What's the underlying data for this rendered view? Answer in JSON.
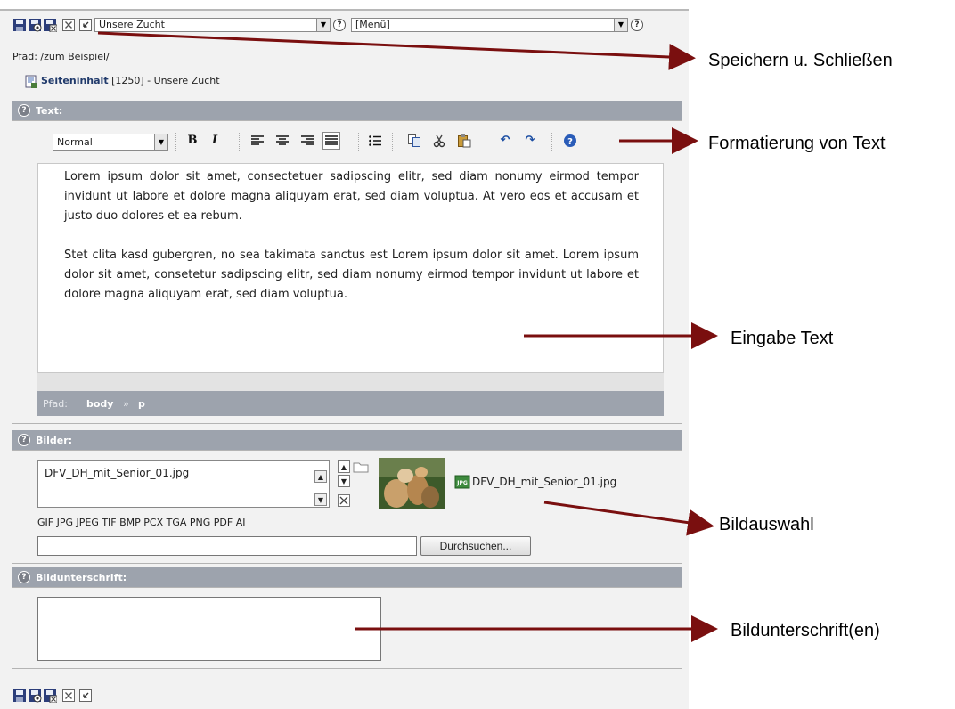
{
  "toolbar": {
    "page_select_value": "Unsere Zucht",
    "menu_select_value": "[Menü]",
    "icons": [
      "save-icon",
      "save-view-icon",
      "save-close-icon",
      "close-icon",
      "undo-icon"
    ]
  },
  "path_text": "Pfad: /zum Beispiel/",
  "record": {
    "type": "Seiteninhalt",
    "id": " [1250] - Unsere Zucht"
  },
  "text_section": {
    "header": "Text:",
    "format_select": "Normal",
    "paragraphs": [
      "Lorem ipsum dolor sit amet, consectetuer sadipscing elitr, sed diam nonumy eirmod tempor invidunt ut labore et dolore magna aliquyam erat, sed diam voluptua. At vero eos et accusam et justo duo dolores et ea rebum.",
      "Stet clita kasd gubergren, no sea takimata sanctus est Lorem ipsum dolor sit amet. Lorem ipsum dolor sit amet, consetetur sadipscing elitr, sed diam nonumy eirmod tempor invidunt ut labore et dolore magna aliquyam erat, sed diam voluptua."
    ],
    "path_label": "Pfad:",
    "path_body": "body",
    "path_sep": "»",
    "path_p": "p"
  },
  "images_section": {
    "header": "Bilder:",
    "list_item": "DFV_DH_mit_Senior_01.jpg",
    "file_label": "DFV_DH_mit_Senior_01.jpg",
    "allowed_types": "GIF JPG JPEG TIF BMP PCX TGA PNG PDF AI",
    "file_input_value": "",
    "browse_button": "Durchsuchen..."
  },
  "caption_section": {
    "header": "Bildunterschrift:",
    "caption_value": ""
  },
  "annotations": {
    "save_close": "Speichern u. Schließen",
    "formatting": "Formatierung von Text",
    "input_text": "Eingabe Text",
    "image_select": "Bildauswahl",
    "caption": "Bildunterschrift(en)"
  },
  "colors": {
    "section_header": "#9da3ad",
    "panel": "#f2f2f2",
    "arrow": "#7a0f0f",
    "link": "#203a6b"
  }
}
